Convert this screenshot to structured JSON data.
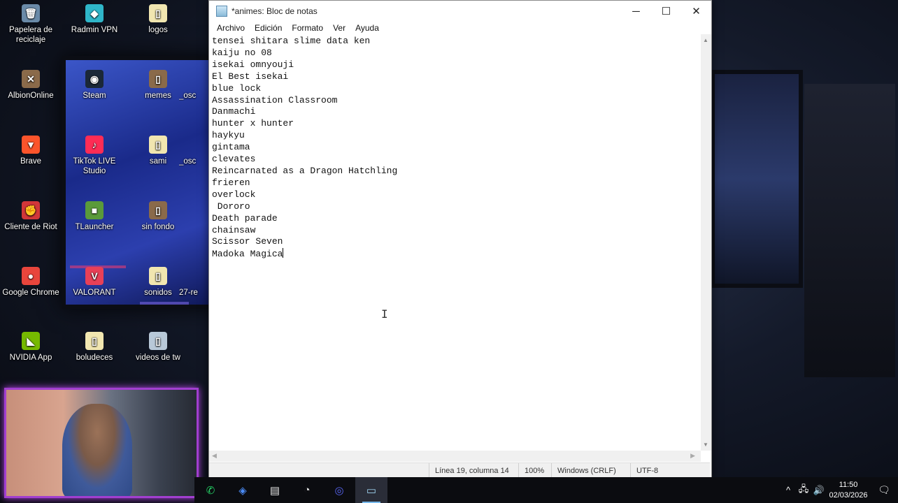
{
  "desktop": {
    "icons": [
      {
        "label": "Papelera de reciclaje",
        "symbol": "🗑",
        "color": "#6a8aa8"
      },
      {
        "label": "Radmin VPN",
        "symbol": "◆",
        "color": "#2fb6c9"
      },
      {
        "label": "logos",
        "symbol": "▯",
        "color": "#f1e6b0"
      },
      {
        "label": "AlbionOnline",
        "symbol": "✕",
        "color": "#8a6a4a"
      },
      {
        "label": "Steam",
        "symbol": "◉",
        "color": "#1b2838"
      },
      {
        "label": "memes",
        "symbol": "▯",
        "color": "#8a6a4a"
      },
      {
        "label": "_osc",
        "symbol": "",
        "color": "transparent"
      },
      {
        "label": "Brave",
        "symbol": "▼",
        "color": "#fb542b"
      },
      {
        "label": "TikTok LIVE Studio",
        "symbol": "♪",
        "color": "#fe2c55"
      },
      {
        "label": "sami",
        "symbol": "▯",
        "color": "#f1e6b0"
      },
      {
        "label": "_osc",
        "symbol": "",
        "color": "transparent"
      },
      {
        "label": "Cliente de Riot",
        "symbol": "✊",
        "color": "#d13639"
      },
      {
        "label": "TLauncher",
        "symbol": "■",
        "color": "#5a9a3a"
      },
      {
        "label": "sin fondo",
        "symbol": "▯",
        "color": "#8a6a4a"
      },
      {
        "label": "Google Chrome",
        "symbol": "●",
        "color": "#e8453c"
      },
      {
        "label": "VALORANT",
        "symbol": "V",
        "color": "#e84057"
      },
      {
        "label": "sonidos",
        "symbol": "▯",
        "color": "#f1e6b0"
      },
      {
        "label": "27-re",
        "symbol": "",
        "color": "transparent"
      },
      {
        "label": "NVIDIA App",
        "symbol": "◣",
        "color": "#76b900"
      },
      {
        "label": "boludeces",
        "symbol": "▯",
        "color": "#f1e6b0"
      },
      {
        "label": "videos de tw",
        "symbol": "▯",
        "color": "#b8c8d8"
      }
    ]
  },
  "notepad": {
    "title": "*animes: Bloc de notas",
    "menu": [
      "Archivo",
      "Edición",
      "Formato",
      "Ver",
      "Ayuda"
    ],
    "window_buttons": {
      "minimize": "─",
      "maximize": "☐",
      "close": "✕"
    },
    "lines": [
      "tensei shitara slime data ken",
      "kaiju no 08",
      "isekai omnyouji",
      "El Best isekai",
      "blue lock",
      "Assassination Classroom",
      "Danmachi",
      "hunter x hunter",
      "haykyu",
      "gintama",
      "clevates",
      "Reincarnated as a Dragon Hatchling",
      "frieren",
      "overlock",
      " Dororo",
      "Death parade",
      "chainsaw",
      "Scissor Seven",
      "Madoka Magica"
    ],
    "status": {
      "position": "Línea 19, columna 14",
      "zoom": "100%",
      "line_ending": "Windows (CRLF)",
      "encoding": "UTF-8"
    }
  },
  "taskbar": {
    "apps": [
      {
        "name": "whatsapp",
        "symbol": "✆",
        "color": "#25d366"
      },
      {
        "name": "app-diamond",
        "symbol": "◈",
        "color": "#4b8bf5"
      },
      {
        "name": "app-window",
        "symbol": "▤",
        "color": "#e0e0e0"
      },
      {
        "name": "app-gauge",
        "symbol": "◔",
        "color": "#e0e0e0"
      },
      {
        "name": "discord",
        "symbol": "◎",
        "color": "#5865f2"
      },
      {
        "name": "notepad",
        "symbol": "▭",
        "color": "#9fd3f0"
      }
    ],
    "tray": {
      "chevron": "^",
      "network": "🖧",
      "volume": "🔊",
      "notifications": "🗨"
    },
    "time": "11:50",
    "date": "02/03/2026"
  }
}
